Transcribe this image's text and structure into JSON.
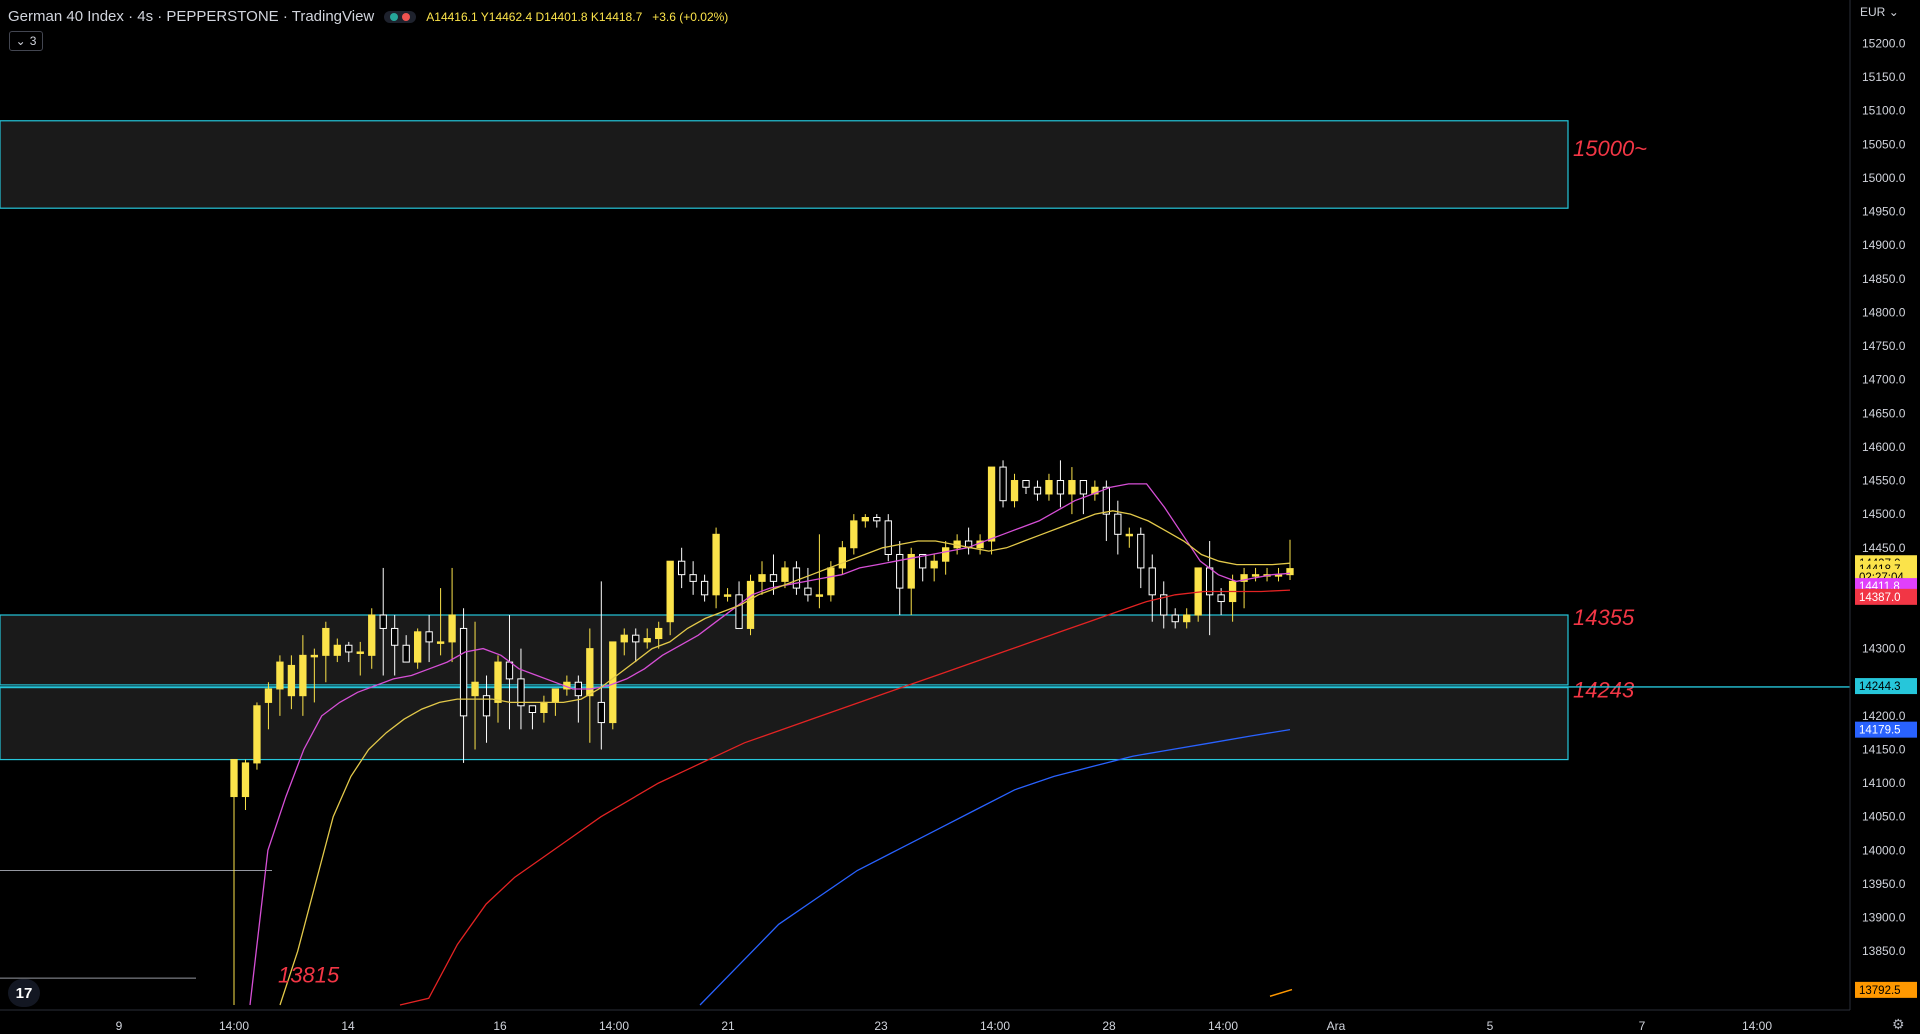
{
  "header": {
    "title": "German 40 Index · 4s · PEPPERSTONE · TradingView",
    "ohlc": "A14416.1  Y14462.4  D14401.8  K14418.7",
    "change": "+3.6 (+0.02%)",
    "indicators_count": "3",
    "currency": "EUR"
  },
  "icons": {
    "collapse": "chevron-down-icon",
    "status": "status-dot-icon",
    "logo": "tradingview-logo-icon",
    "settings": "gear-icon"
  },
  "colors": {
    "zone_border": "#26c6da",
    "zone_fill": "#1a1a1a",
    "candle_up": "#fbe34a",
    "candle_down": "#ffffff",
    "ma_fast": "#d64fd6",
    "ma_mid": "#e3c94a",
    "ma_slow": "#e32323",
    "ma_long": "#2962ff",
    "zone_label": "#f23645"
  },
  "chart_data": {
    "type": "candlestick",
    "y_range": [
      13770,
      15220
    ],
    "y_ticks": [
      15200,
      15150,
      15100,
      15050,
      15000,
      14950,
      14900,
      14850,
      14800,
      14750,
      14700,
      14650,
      14600,
      14550,
      14500,
      14450,
      14300,
      14200,
      14150,
      14100,
      14050,
      14000,
      13950,
      13900,
      13850
    ],
    "x_ticks": [
      "9",
      "14:00",
      "14",
      "16",
      "14:00",
      "21",
      "23",
      "14:00",
      "28",
      "14:00",
      "Ara",
      "5",
      "7",
      "14:00"
    ],
    "x_tick_positions": [
      0.0,
      1.0,
      2.0,
      4.0,
      5.0,
      6.0,
      7.35,
      8.35,
      9.35,
      10.35,
      11.35,
      12.35,
      13.7,
      14.7
    ],
    "candles": [
      [
        14080,
        14135,
        13770,
        14135
      ],
      [
        14080,
        14130,
        14060,
        14135
      ],
      [
        14130,
        14215,
        14120,
        14220
      ],
      [
        14220,
        14240,
        14180,
        14250
      ],
      [
        14240,
        14280,
        14200,
        14290
      ],
      [
        14230,
        14275,
        14210,
        14290
      ],
      [
        14230,
        14290,
        14200,
        14320
      ],
      [
        14290,
        14290,
        14220,
        14300
      ],
      [
        14290,
        14330,
        14250,
        14340
      ],
      [
        14290,
        14305,
        14280,
        14315
      ],
      [
        14305,
        14295,
        14280,
        14310
      ],
      [
        14295,
        14295,
        14260,
        14310
      ],
      [
        14290,
        14350,
        14270,
        14360
      ],
      [
        14350,
        14330,
        14260,
        14420
      ],
      [
        14330,
        14305,
        14260,
        14350
      ],
      [
        14305,
        14280,
        14280,
        14320
      ],
      [
        14280,
        14325,
        14270,
        14330
      ],
      [
        14325,
        14310,
        14280,
        14350
      ],
      [
        14310,
        14310,
        14290,
        14390
      ],
      [
        14310,
        14350,
        14280,
        14420
      ],
      [
        14330,
        14200,
        14130,
        14360
      ],
      [
        14230,
        14250,
        14150,
        14340
      ],
      [
        14230,
        14200,
        14160,
        14260
      ],
      [
        14220,
        14280,
        14190,
        14290
      ],
      [
        14280,
        14255,
        14180,
        14350
      ],
      [
        14255,
        14215,
        14180,
        14300
      ],
      [
        14215,
        14205,
        14180,
        14210
      ],
      [
        14205,
        14220,
        14190,
        14230
      ],
      [
        14220,
        14240,
        14200,
        14240
      ],
      [
        14240,
        14250,
        14230,
        14260
      ],
      [
        14250,
        14230,
        14190,
        14260
      ],
      [
        14230,
        14300,
        14160,
        14330
      ],
      [
        14220,
        14190,
        14150,
        14400
      ],
      [
        14190,
        14310,
        14180,
        14310
      ],
      [
        14310,
        14320,
        14290,
        14330
      ],
      [
        14320,
        14310,
        14280,
        14330
      ],
      [
        14310,
        14315,
        14300,
        14330
      ],
      [
        14315,
        14330,
        14300,
        14340
      ],
      [
        14340,
        14430,
        14320,
        14430
      ],
      [
        14430,
        14410,
        14390,
        14450
      ],
      [
        14410,
        14400,
        14380,
        14430
      ],
      [
        14400,
        14380,
        14370,
        14410
      ],
      [
        14380,
        14470,
        14360,
        14480
      ],
      [
        14380,
        14380,
        14370,
        14390
      ],
      [
        14380,
        14330,
        14330,
        14400
      ],
      [
        14330,
        14400,
        14320,
        14410
      ],
      [
        14400,
        14410,
        14380,
        14430
      ],
      [
        14410,
        14400,
        14380,
        14440
      ],
      [
        14400,
        14420,
        14390,
        14430
      ],
      [
        14420,
        14390,
        14380,
        14430
      ],
      [
        14390,
        14380,
        14370,
        14420
      ],
      [
        14380,
        14380,
        14360,
        14470
      ],
      [
        14380,
        14420,
        14370,
        14430
      ],
      [
        14420,
        14450,
        14410,
        14460
      ],
      [
        14450,
        14490,
        14440,
        14500
      ],
      [
        14490,
        14495,
        14480,
        14500
      ],
      [
        14495,
        14490,
        14480,
        14500
      ],
      [
        14490,
        14440,
        14430,
        14500
      ],
      [
        14440,
        14390,
        14350,
        14460
      ],
      [
        14390,
        14440,
        14350,
        14450
      ],
      [
        14440,
        14420,
        14400,
        14440
      ],
      [
        14420,
        14430,
        14400,
        14440
      ],
      [
        14430,
        14450,
        14410,
        14460
      ],
      [
        14450,
        14460,
        14440,
        14470
      ],
      [
        14460,
        14450,
        14440,
        14480
      ],
      [
        14450,
        14460,
        14440,
        14470
      ],
      [
        14460,
        14570,
        14440,
        14570
      ],
      [
        14570,
        14520,
        14510,
        14580
      ],
      [
        14520,
        14550,
        14510,
        14560
      ],
      [
        14550,
        14540,
        14530,
        14550
      ],
      [
        14540,
        14530,
        14520,
        14550
      ],
      [
        14530,
        14550,
        14520,
        14560
      ],
      [
        14550,
        14530,
        14510,
        14580
      ],
      [
        14530,
        14550,
        14500,
        14570
      ],
      [
        14550,
        14530,
        14500,
        14550
      ],
      [
        14530,
        14540,
        14520,
        14550
      ],
      [
        14540,
        14500,
        14460,
        14550
      ],
      [
        14500,
        14470,
        14440,
        14520
      ],
      [
        14470,
        14470,
        14450,
        14480
      ],
      [
        14470,
        14420,
        14390,
        14480
      ],
      [
        14420,
        14380,
        14340,
        14440
      ],
      [
        14380,
        14350,
        14330,
        14400
      ],
      [
        14350,
        14340,
        14330,
        14360
      ],
      [
        14340,
        14350,
        14330,
        14360
      ],
      [
        14350,
        14420,
        14340,
        14420
      ],
      [
        14420,
        14380,
        14320,
        14460
      ],
      [
        14380,
        14370,
        14350,
        14390
      ],
      [
        14370,
        14400,
        14340,
        14410
      ],
      [
        14400,
        14410,
        14360,
        14420
      ],
      [
        14410,
        14410,
        14400,
        14420
      ],
      [
        14410,
        14410,
        14400,
        14420
      ],
      [
        14410,
        14410,
        14400,
        14420
      ],
      [
        14410,
        14419,
        14402,
        14462
      ]
    ],
    "ma_fast": [
      [
        0,
        13770
      ],
      [
        1,
        14000
      ],
      [
        2,
        14080
      ],
      [
        3,
        14150
      ],
      [
        4,
        14200
      ],
      [
        5,
        14220
      ],
      [
        6,
        14235
      ],
      [
        7,
        14245
      ],
      [
        8,
        14255
      ],
      [
        9,
        14260
      ],
      [
        10,
        14270
      ],
      [
        11,
        14280
      ],
      [
        12,
        14295
      ],
      [
        13,
        14300
      ],
      [
        14,
        14290
      ],
      [
        15,
        14270
      ],
      [
        16,
        14260
      ],
      [
        17,
        14250
      ],
      [
        18,
        14240
      ],
      [
        19,
        14240
      ],
      [
        20,
        14245
      ],
      [
        21,
        14255
      ],
      [
        22,
        14270
      ],
      [
        23,
        14290
      ],
      [
        24,
        14305
      ],
      [
        25,
        14320
      ],
      [
        26,
        14340
      ],
      [
        27,
        14360
      ],
      [
        28,
        14380
      ],
      [
        29,
        14390
      ],
      [
        30,
        14395
      ],
      [
        31,
        14400
      ],
      [
        32,
        14405
      ],
      [
        33,
        14410
      ],
      [
        34,
        14420
      ],
      [
        35,
        14425
      ],
      [
        36,
        14430
      ],
      [
        37,
        14435
      ],
      [
        38,
        14440
      ],
      [
        39,
        14445
      ],
      [
        40,
        14450
      ],
      [
        41,
        14460
      ],
      [
        42,
        14470
      ],
      [
        43,
        14480
      ],
      [
        44,
        14490
      ],
      [
        45,
        14505
      ],
      [
        46,
        14520
      ],
      [
        47,
        14530
      ],
      [
        48,
        14540
      ],
      [
        49,
        14545
      ],
      [
        50,
        14545
      ],
      [
        51,
        14510
      ],
      [
        52,
        14470
      ],
      [
        53,
        14430
      ],
      [
        54,
        14410
      ],
      [
        55,
        14400
      ],
      [
        56,
        14405
      ],
      [
        57,
        14410
      ],
      [
        58,
        14412
      ]
    ],
    "ma_mid": [
      [
        0,
        13770
      ],
      [
        1,
        13850
      ],
      [
        2,
        13950
      ],
      [
        3,
        14050
      ],
      [
        4,
        14110
      ],
      [
        5,
        14150
      ],
      [
        6,
        14175
      ],
      [
        7,
        14195
      ],
      [
        8,
        14210
      ],
      [
        9,
        14220
      ],
      [
        10,
        14225
      ],
      [
        11,
        14225
      ],
      [
        12,
        14225
      ],
      [
        13,
        14220
      ],
      [
        14,
        14220
      ],
      [
        15,
        14220
      ],
      [
        16,
        14220
      ],
      [
        17,
        14225
      ],
      [
        18,
        14240
      ],
      [
        19,
        14260
      ],
      [
        20,
        14280
      ],
      [
        21,
        14300
      ],
      [
        22,
        14310
      ],
      [
        23,
        14330
      ],
      [
        24,
        14345
      ],
      [
        25,
        14355
      ],
      [
        26,
        14365
      ],
      [
        27,
        14380
      ],
      [
        28,
        14390
      ],
      [
        29,
        14400
      ],
      [
        30,
        14410
      ],
      [
        31,
        14420
      ],
      [
        32,
        14430
      ],
      [
        33,
        14440
      ],
      [
        34,
        14450
      ],
      [
        35,
        14455
      ],
      [
        36,
        14460
      ],
      [
        37,
        14460
      ],
      [
        38,
        14455
      ],
      [
        39,
        14450
      ],
      [
        40,
        14445
      ],
      [
        41,
        14450
      ],
      [
        42,
        14460
      ],
      [
        43,
        14470
      ],
      [
        44,
        14480
      ],
      [
        45,
        14490
      ],
      [
        46,
        14500
      ],
      [
        47,
        14505
      ],
      [
        48,
        14500
      ],
      [
        49,
        14490
      ],
      [
        50,
        14475
      ],
      [
        51,
        14460
      ],
      [
        52,
        14440
      ],
      [
        53,
        14430
      ],
      [
        54,
        14425
      ],
      [
        55,
        14425
      ],
      [
        56,
        14425
      ],
      [
        57,
        14427
      ]
    ],
    "ma_slow": [
      [
        0,
        13770
      ],
      [
        1,
        13780
      ],
      [
        2,
        13860
      ],
      [
        3,
        13920
      ],
      [
        4,
        13960
      ],
      [
        5,
        13990
      ],
      [
        6,
        14020
      ],
      [
        7,
        14050
      ],
      [
        8,
        14075
      ],
      [
        9,
        14100
      ],
      [
        10,
        14120
      ],
      [
        11,
        14140
      ],
      [
        12,
        14160
      ],
      [
        13,
        14175
      ],
      [
        14,
        14190
      ],
      [
        15,
        14205
      ],
      [
        16,
        14220
      ],
      [
        17,
        14235
      ],
      [
        18,
        14250
      ],
      [
        19,
        14265
      ],
      [
        20,
        14280
      ],
      [
        21,
        14295
      ],
      [
        22,
        14310
      ],
      [
        23,
        14325
      ],
      [
        24,
        14340
      ],
      [
        25,
        14355
      ],
      [
        26,
        14370
      ],
      [
        27,
        14380
      ],
      [
        28,
        14385
      ],
      [
        29,
        14385
      ],
      [
        30,
        14385
      ],
      [
        31,
        14387
      ]
    ],
    "ma_long": [
      [
        0,
        13770
      ],
      [
        1,
        13830
      ],
      [
        2,
        13890
      ],
      [
        3,
        13930
      ],
      [
        4,
        13970
      ],
      [
        5,
        14000
      ],
      [
        6,
        14030
      ],
      [
        7,
        14060
      ],
      [
        8,
        14090
      ],
      [
        9,
        14110
      ],
      [
        10,
        14125
      ],
      [
        11,
        14140
      ],
      [
        12,
        14150
      ],
      [
        13,
        14160
      ],
      [
        14,
        14170
      ],
      [
        15,
        14179.5
      ]
    ],
    "right_labels": [
      {
        "price": 14427.0,
        "text": "14427.0",
        "bg": "#fbe34a",
        "fg": "#000"
      },
      {
        "price": 14418.7,
        "text": "14418.7",
        "bg": "#fbe34a",
        "fg": "#000"
      },
      {
        "price": 14406.5,
        "text": "02:27:04",
        "bg": "#fbe34a",
        "fg": "#000"
      },
      {
        "price": 14393.0,
        "text": "14411.8",
        "bg": "#e040fb",
        "fg": "#fff"
      },
      {
        "price": 14377.0,
        "text": "14387.0",
        "bg": "#f23645",
        "fg": "#fff"
      },
      {
        "price": 14244.3,
        "text": "14244.3",
        "bg": "#26c6da",
        "fg": "#000"
      },
      {
        "price": 14179.5,
        "text": "14179.5",
        "bg": "#2962ff",
        "fg": "#fff"
      },
      {
        "price": 13792.5,
        "text": "13792.5",
        "bg": "#ff9800",
        "fg": "#000"
      }
    ],
    "zones": [
      {
        "top": 15085,
        "bottom": 14955,
        "label": "15000~"
      },
      {
        "top": 14350,
        "bottom": 14246,
        "label": "14355"
      },
      {
        "top": 14242,
        "bottom": 14135,
        "label": "14243"
      }
    ],
    "horizontal_line": {
      "price": 14243,
      "text": "14244.3"
    },
    "stray_lines": [
      13970,
      13810
    ],
    "annotations": [
      {
        "price": 13815,
        "text": "13815"
      }
    ]
  }
}
